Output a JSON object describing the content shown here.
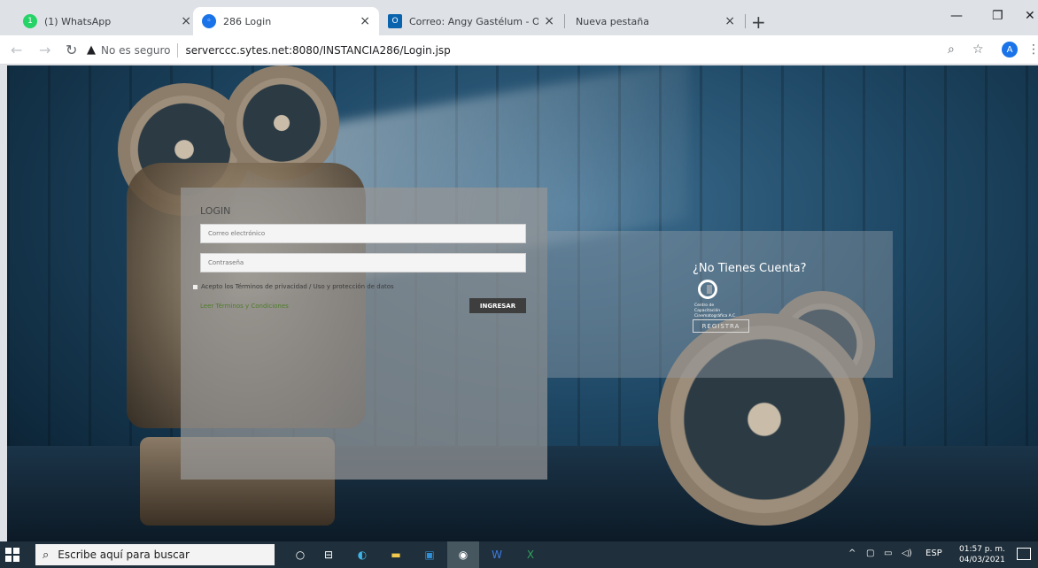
{
  "browser": {
    "tabs": [
      {
        "title": "(1) WhatsApp",
        "favicon": "whatsapp-icon",
        "active": false
      },
      {
        "title": "286 Login",
        "favicon": "site-icon",
        "active": true
      },
      {
        "title": "Correo: Angy Gastélum - Outlook",
        "favicon": "outlook-icon",
        "active": false
      },
      {
        "title": "Nueva pestaña",
        "favicon": "",
        "active": false
      }
    ],
    "new_tab": "+",
    "security_label": "No es seguro",
    "url": "serverccc.sytes.net:8080/INSTANCIA286/Login.jsp",
    "profile_initial": "A"
  },
  "login": {
    "title": "LOGIN",
    "email_placeholder": "Correo electrónico",
    "password_placeholder": "Contraseña",
    "terms_label": "Acepto los Términos de privacidad / Uso y protección de datos",
    "read_terms_link": "Leer Términos y Condiciones",
    "submit_label": "INGRESAR"
  },
  "register": {
    "question": "¿No Tienes Cuenta?",
    "logo_text": "Centro de Capacitación Cinematográfica A.C.",
    "button_label": "REGISTRA"
  },
  "taskbar": {
    "search_placeholder": "Escribe aquí para buscar",
    "language": "ESP",
    "time": "01:57 p. m.",
    "date": "04/03/2021"
  },
  "colors": {
    "accent_green": "#4e7d2a",
    "button_dark": "#3e3e3e",
    "taskbar_bg": "#1f2f3b",
    "profile_blue": "#1a73e8"
  }
}
